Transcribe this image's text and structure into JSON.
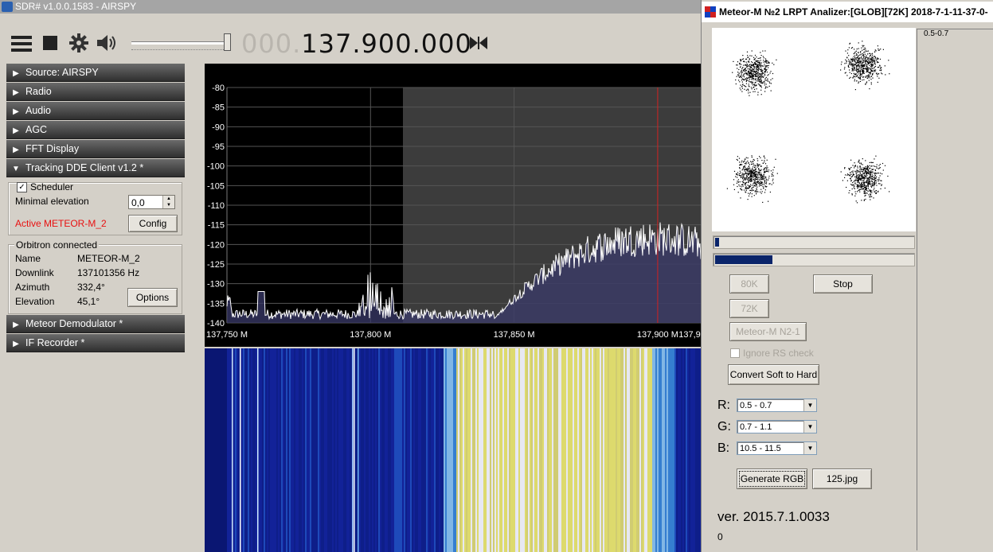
{
  "sdr": {
    "title": "SDR# v1.0.0.1583 - AIRSPY",
    "frequency_dim": "000.",
    "frequency_main": "137.900.000"
  },
  "sections": [
    {
      "label": "Source: AIRSPY",
      "expanded": false
    },
    {
      "label": "Radio",
      "expanded": false
    },
    {
      "label": "Audio",
      "expanded": false
    },
    {
      "label": "AGC",
      "expanded": false
    },
    {
      "label": "FFT Display",
      "expanded": false
    },
    {
      "label": "Tracking DDE Client v1.2 *",
      "expanded": true
    },
    {
      "label": "Meteor Demodulator *",
      "expanded": false
    },
    {
      "label": "IF Recorder *",
      "expanded": false
    }
  ],
  "icons": {
    "expand": "▶",
    "collapse": "▼",
    "check": "✓",
    "dropdown": "▼"
  },
  "tracking": {
    "scheduler_label": "Scheduler",
    "scheduler_checked": true,
    "min_elev_label": "Minimal elevation",
    "min_elev_value": "0,0",
    "active_label": "Active METEOR-M_2",
    "active_color": "#e81010",
    "config_button": "Config"
  },
  "orbitron": {
    "title": "Orbitron connected",
    "rows": [
      {
        "label": "Name",
        "value": "METEOR-M_2"
      },
      {
        "label": "Downlink",
        "value": "137101356 Hz"
      },
      {
        "label": "Azimuth",
        "value": "332,4°"
      },
      {
        "label": "Elevation",
        "value": "45,1°"
      }
    ],
    "options_button": "Options"
  },
  "chart_data": {
    "type": "line",
    "ylim": [
      -140,
      -80
    ],
    "yticks": [
      "-80",
      "-85",
      "-90",
      "-95",
      "-100",
      "-105",
      "-110",
      "-115",
      "-120",
      "-125",
      "-130",
      "-135",
      "-140"
    ],
    "xlim": [
      137.75,
      137.915
    ],
    "xticks": [
      "137,750 M",
      "137,800 M",
      "137,850 M",
      "137,900 M",
      "137,9"
    ],
    "center_line": 137.9,
    "center_color": "#d02020",
    "line_color": "#ffffff",
    "fill_color": "#3a3a6a"
  },
  "meteor": {
    "title": "Meteor-M №2 LRPT Analizer:[GLOB][72K] 2018-7-1-11-37-0-",
    "progress1": 0.02,
    "progress2": 0.29,
    "btn_80k": "80K",
    "btn_stop": "Stop",
    "btn_72k": "72K",
    "btn_n21": "Meteor-M N2-1",
    "ignore_rs": "Ignore RS check",
    "convert_btn": "Convert Soft to Hard",
    "r_label": "R:",
    "r_value": "0.5 - 0.7",
    "g_label": "G:",
    "g_value": "0.7 - 1.1",
    "b_label": "B:",
    "b_value": "10.5 - 11.5",
    "generate_btn": "Generate RGB",
    "jpg_btn": "125.jpg",
    "version": "ver. 2015.7.1.0033",
    "status": "0",
    "side_label": "0.5-0.7"
  }
}
